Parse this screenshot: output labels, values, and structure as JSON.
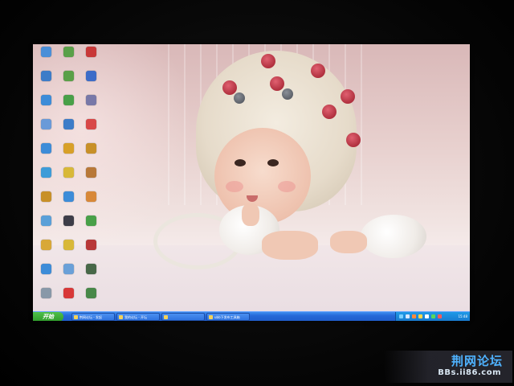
{
  "desktop": {
    "icons": [
      {
        "label": "",
        "icon": "network-icon",
        "color": "#4a8fd8"
      },
      {
        "label": "",
        "icon": "app-icon",
        "color": "#5aa048"
      },
      {
        "label": "",
        "icon": "player-icon",
        "color": "#c83838"
      },
      {
        "label": "",
        "icon": "computer-icon",
        "color": "#3d7cc8"
      },
      {
        "label": "",
        "icon": "folder-icon",
        "color": "#5aa048"
      },
      {
        "label": "",
        "icon": "app-icon",
        "color": "#3d6cc8"
      },
      {
        "label": "",
        "icon": "computer-icon",
        "color": "#3d8cd8"
      },
      {
        "label": "",
        "icon": "app-icon",
        "color": "#48a048"
      },
      {
        "label": "",
        "icon": "app-icon",
        "color": "#7878a8"
      },
      {
        "label": "",
        "icon": "recycle-bin-icon",
        "color": "#6a9ad8"
      },
      {
        "label": "",
        "icon": "app-icon",
        "color": "#3d7cc8"
      },
      {
        "label": "",
        "icon": "app-icon",
        "color": "#d84848"
      },
      {
        "label": "",
        "icon": "app-icon",
        "color": "#3d8cd8"
      },
      {
        "label": "",
        "icon": "app-icon",
        "color": "#d8a028"
      },
      {
        "label": "",
        "icon": "game-icon",
        "color": "#c89028"
      },
      {
        "label": "",
        "icon": "app-icon",
        "color": "#3d9cd8"
      },
      {
        "label": "",
        "icon": "app-icon",
        "color": "#d8b838"
      },
      {
        "label": "",
        "icon": "game-icon",
        "color": "#b87838"
      },
      {
        "label": "",
        "icon": "app-icon",
        "color": "#c89028"
      },
      {
        "label": "",
        "icon": "ie-icon",
        "color": "#3d8cd8"
      },
      {
        "label": "",
        "icon": "app-icon",
        "color": "#d88838"
      },
      {
        "label": "",
        "icon": "app-icon",
        "color": "#5aa0d8"
      },
      {
        "label": "",
        "icon": "app-icon",
        "color": "#3d3d48"
      },
      {
        "label": "",
        "icon": "app-icon",
        "color": "#48a048"
      },
      {
        "label": "",
        "icon": "app-icon",
        "color": "#d8a838"
      },
      {
        "label": "",
        "icon": "app-icon",
        "color": "#d8b838"
      },
      {
        "label": "",
        "icon": "game-icon",
        "color": "#b83838"
      },
      {
        "label": "",
        "icon": "app-icon",
        "color": "#3d8cd8"
      },
      {
        "label": "",
        "icon": "app-icon",
        "color": "#6aa0d8"
      },
      {
        "label": "",
        "icon": "app-icon",
        "color": "#486848"
      },
      {
        "label": "",
        "icon": "document-icon",
        "color": "#8898a8"
      },
      {
        "label": "",
        "icon": "qq-icon",
        "color": "#d83838"
      },
      {
        "label": "",
        "icon": "app-icon",
        "color": "#488848"
      }
    ]
  },
  "taskbar": {
    "start_label": "开始",
    "tasks": [
      {
        "label": "荆网论坛 - 发起"
      },
      {
        "label": "我的论坛 - 开坛"
      },
      {
        "label": ""
      },
      {
        "label": "ubb下发布工具箱"
      }
    ],
    "tray": {
      "icons": [
        {
          "icon": "network-tray-icon",
          "color": "#7ad0ff"
        },
        {
          "icon": "volume-tray-icon",
          "color": "#d8e8ff"
        },
        {
          "icon": "antivirus-tray-icon",
          "color": "#ff8a3a"
        },
        {
          "icon": "qq-tray-icon",
          "color": "#ffd84a"
        },
        {
          "icon": "ime-tray-icon",
          "color": "#ffffff"
        },
        {
          "icon": "security-tray-icon",
          "color": "#5ad85a"
        },
        {
          "icon": "app-tray-icon",
          "color": "#ff5a5a"
        }
      ],
      "clock": "15:48"
    }
  },
  "watermark": {
    "title": "荆网论坛",
    "url": "BBs.ii86.com"
  },
  "colors": {
    "taskbar": "#2468d8",
    "start": "#2f9b2b",
    "watermark_title": "#4fb3ff"
  }
}
